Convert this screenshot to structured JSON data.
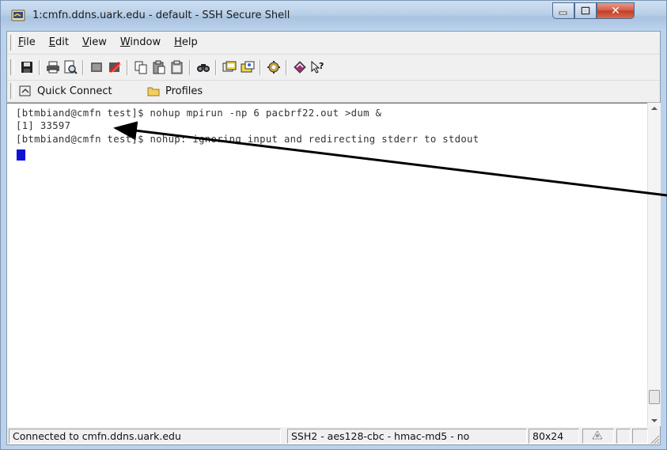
{
  "window": {
    "title": "1:cmfn.ddns.uark.edu - default - SSH Secure Shell",
    "minimize_label": "",
    "maximize_label": "",
    "close_label": "✕"
  },
  "menubar": {
    "items": [
      {
        "underline": "F",
        "rest": "ile"
      },
      {
        "underline": "E",
        "rest": "dit"
      },
      {
        "underline": "V",
        "rest": "iew"
      },
      {
        "underline": "W",
        "rest": "indow"
      },
      {
        "underline": "H",
        "rest": "elp"
      }
    ]
  },
  "toolbar": {
    "icons": [
      "save-icon",
      "print-icon",
      "print-preview-icon",
      "new-terminal-icon",
      "disconnect-icon",
      "copy-icon",
      "paste-icon",
      "paste-alt-icon",
      "find-icon",
      "settings-icon",
      "profile-settings-icon",
      "sftp-icon",
      "help-topics-icon",
      "context-help-icon"
    ]
  },
  "quickbar": {
    "quick_connect_label": "Quick Connect",
    "profiles_label": "Profiles"
  },
  "terminal": {
    "lines": [
      "[btmbiand@cmfn test]$ nohup mpirun -np 6 pacbrf22.out >dum &",
      "[1] 33597",
      "[btmbiand@cmfn test]$ nohup: ignoring input and redirecting stderr to stdout"
    ]
  },
  "statusbar": {
    "connection": "Connected to cmfn.ddns.uark.edu",
    "cipher": "SSH2 - aes128-cbc - hmac-md5 - no",
    "size": "80x24",
    "extra": ""
  },
  "colors": {
    "cursor": "#1010d8",
    "titlebar": "#b8cfe8",
    "close_button": "#c13c24"
  }
}
